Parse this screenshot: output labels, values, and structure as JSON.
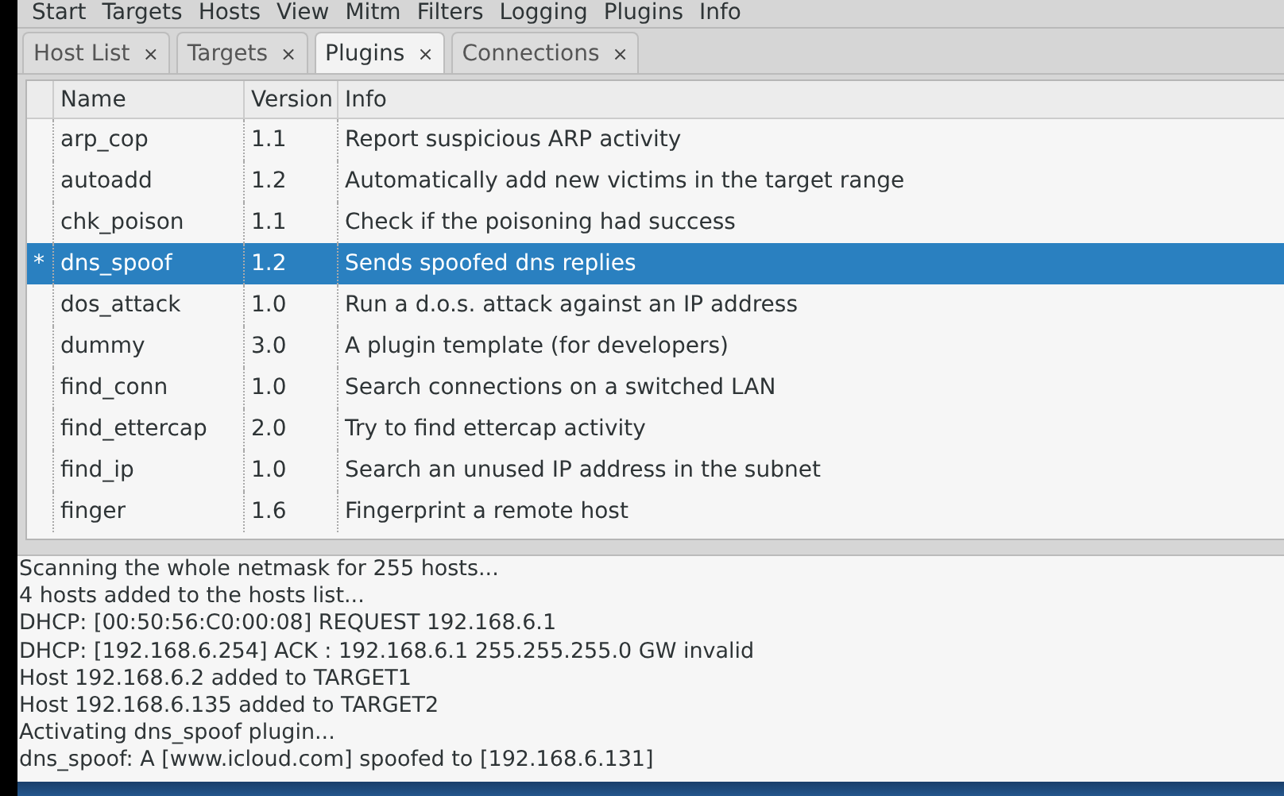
{
  "menu": [
    "Start",
    "Targets",
    "Hosts",
    "View",
    "Mitm",
    "Filters",
    "Logging",
    "Plugins",
    "Info"
  ],
  "tabs": [
    {
      "label": "Host List",
      "close": "×",
      "selected": false
    },
    {
      "label": "Targets",
      "close": "×",
      "selected": false
    },
    {
      "label": "Plugins",
      "close": "×",
      "selected": true
    },
    {
      "label": "Connections",
      "close": "×",
      "selected": false
    }
  ],
  "table": {
    "columns": [
      "Name",
      "Version",
      "Info"
    ],
    "rows": [
      {
        "mark": "",
        "name": "arp_cop",
        "version": "1.1",
        "info": "Report suspicious ARP activity",
        "selected": false
      },
      {
        "mark": "",
        "name": "autoadd",
        "version": "1.2",
        "info": "Automatically add new victims in the target range",
        "selected": false
      },
      {
        "mark": "",
        "name": "chk_poison",
        "version": "1.1",
        "info": "Check if the poisoning had success",
        "selected": false
      },
      {
        "mark": "*",
        "name": "dns_spoof",
        "version": "1.2",
        "info": "Sends spoofed dns replies",
        "selected": true
      },
      {
        "mark": "",
        "name": "dos_attack",
        "version": "1.0",
        "info": "Run a d.o.s. attack against an IP address",
        "selected": false
      },
      {
        "mark": "",
        "name": "dummy",
        "version": "3.0",
        "info": "A plugin template (for developers)",
        "selected": false
      },
      {
        "mark": "",
        "name": "find_conn",
        "version": "1.0",
        "info": "Search connections on a switched LAN",
        "selected": false
      },
      {
        "mark": "",
        "name": "find_ettercap",
        "version": "2.0",
        "info": "Try to find ettercap activity",
        "selected": false
      },
      {
        "mark": "",
        "name": "find_ip",
        "version": "1.0",
        "info": "Search an unused IP address in the subnet",
        "selected": false
      },
      {
        "mark": "",
        "name": "finger",
        "version": "1.6",
        "info": "Fingerprint a remote host",
        "selected": false
      }
    ]
  },
  "log": [
    "Scanning the whole netmask for 255 hosts...",
    "4 hosts added to the hosts list...",
    "DHCP: [00:50:56:C0:00:08] REQUEST 192.168.6.1",
    "DHCP: [192.168.6.254] ACK : 192.168.6.1 255.255.255.0 GW invalid",
    "Host 192.168.6.2 added to TARGET1",
    "Host 192.168.6.135 added to TARGET2",
    "Activating dns_spoof plugin...",
    "dns_spoof: A [www.icloud.com] spoofed to [192.168.6.131]"
  ]
}
